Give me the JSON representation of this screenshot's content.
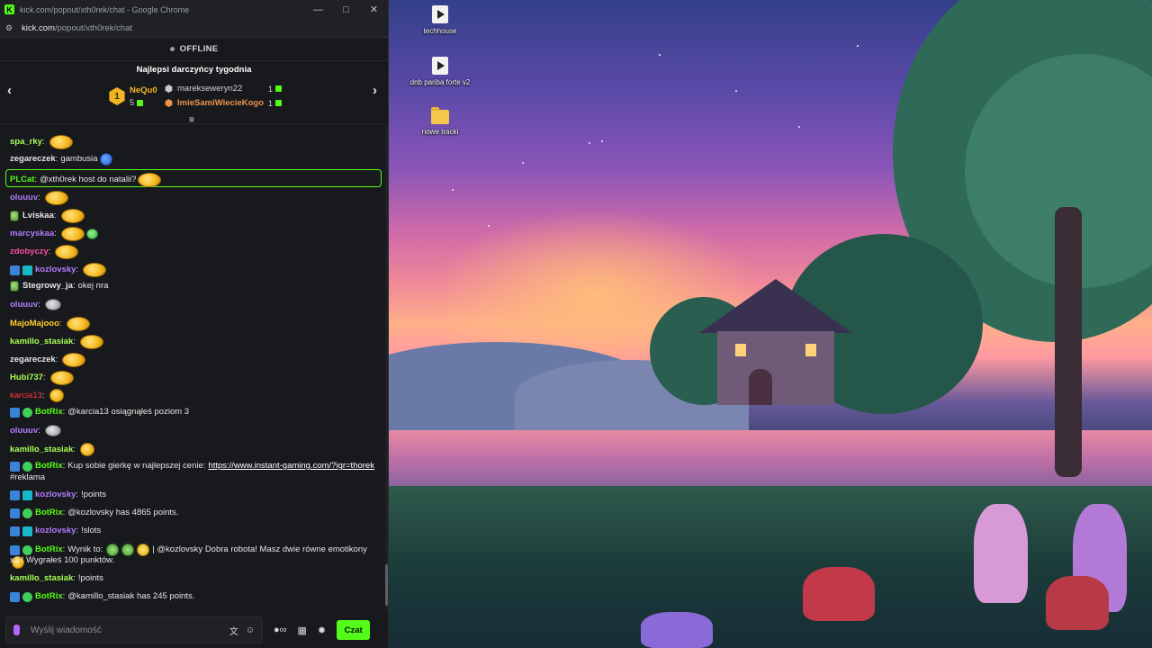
{
  "window": {
    "title": "kick.com/popout/xth0rek/chat - Google Chrome",
    "url_domain": "kick.com",
    "url_path": "/popout/xth0rek/chat",
    "controls": {
      "minimize": "—",
      "maximize": "□",
      "close": "✕"
    }
  },
  "stream": {
    "status": "OFFLINE"
  },
  "leaderboard": {
    "title": "Najlepsi darczyńcy tygodnia",
    "first": {
      "rank": "1",
      "name": "NeQu0",
      "count": "5"
    },
    "others": [
      {
        "name": "marekseweryn22",
        "count": "1",
        "color": "#d3d3d3"
      },
      {
        "name": "ImieSamiWiecieKogo",
        "count": "1",
        "color": "#f0934a"
      }
    ]
  },
  "chat": [
    {
      "user": "spa_rky",
      "color": "#a6ff56",
      "text": ""
    },
    {
      "user": "zegareczek",
      "color": "#ffffff",
      "text": "gambusia"
    },
    {
      "user": "PLCat",
      "color": "#53fc18",
      "text": "@xth0rek host do natalii?"
    },
    {
      "user": "oluuuv",
      "color": "#b27cff",
      "text": ""
    },
    {
      "user": "Lviskaa",
      "color": "#e6e6e6",
      "text": ""
    },
    {
      "user": "marcyskaa",
      "color": "#b27cff",
      "text": ""
    },
    {
      "user": "zdobyczy",
      "color": "#ff4da6",
      "text": ""
    },
    {
      "user": "kozlovsky",
      "color": "#b27cff",
      "text": ""
    },
    {
      "user": "Stegrowy_ja",
      "color": "#e6e6e6",
      "text": "okej nra"
    },
    {
      "user": "oluuuv",
      "color": "#b27cff",
      "text": ""
    },
    {
      "user": "MajoMajooo",
      "color": "#ffd02b",
      "text": ""
    },
    {
      "user": "kamillo_stasiak",
      "color": "#a6ff56",
      "text": ""
    },
    {
      "user": "zegareczek",
      "color": "#ffffff",
      "text": ""
    },
    {
      "user": "Hubi737",
      "color": "#a6ff56",
      "text": ""
    },
    {
      "user": "karcia13",
      "color": "#ff3b3b",
      "text": ""
    },
    {
      "user": "BotRix",
      "color": "#53fc18",
      "text": "@karcia13 osiągnąłeś poziom 3"
    },
    {
      "user": "oluuuv",
      "color": "#b27cff",
      "text": ""
    },
    {
      "user": "kamillo_stasiak",
      "color": "#a6ff56",
      "text": ""
    },
    {
      "user": "BotRix",
      "color": "#53fc18",
      "text": "Kup sobie gierkę w najlepszej cenie:",
      "link": "https://www.instant-gaming.com/?igr=thorek",
      "text2": "#reklama"
    },
    {
      "user": "kozlovsky",
      "color": "#b27cff",
      "text": "!points"
    },
    {
      "user": "BotRix",
      "color": "#53fc18",
      "text": "@kozlovsky has 4865 points."
    },
    {
      "user": "kozlovsky",
      "color": "#b27cff",
      "text": "!slots"
    },
    {
      "user": "BotRix",
      "color": "#53fc18",
      "text": "Wynik to:",
      "text_mid": "| @kozlovsky Dobra robota! Masz dwie równe emotikony",
      "text2": "x2 ! Wygrałeś 100 punktów."
    },
    {
      "user": "kamillo_stasiak",
      "color": "#a6ff56",
      "text": "!points"
    },
    {
      "user": "BotRix",
      "color": "#53fc18",
      "text": "@kamillo_stasiak has 245 points."
    }
  ],
  "input": {
    "placeholder": "Wyślij wiadomość",
    "send_label": "Czat"
  },
  "desktop_icons": [
    {
      "label": "techhouse"
    },
    {
      "label": "dnb pariba forte v2"
    },
    {
      "label": "nowe tracki"
    }
  ],
  "colors": {
    "accent": "#53fc18",
    "panel": "#18191c"
  }
}
